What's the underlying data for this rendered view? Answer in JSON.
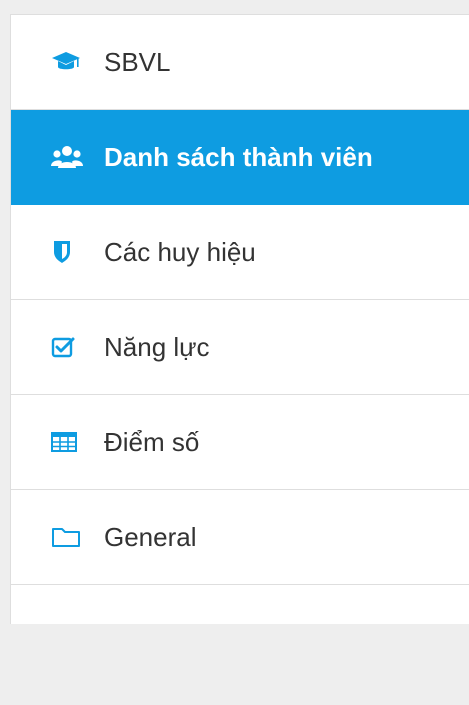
{
  "nav": {
    "items": [
      {
        "label": "SBVL",
        "icon": "graduation-cap-icon",
        "active": false
      },
      {
        "label": "Danh sách thành viên",
        "icon": "users-icon",
        "active": true
      },
      {
        "label": "Các huy hiệu",
        "icon": "shield-icon",
        "active": false
      },
      {
        "label": "Năng lực",
        "icon": "checkbox-icon",
        "active": false
      },
      {
        "label": "Điểm số",
        "icon": "table-icon",
        "active": false
      },
      {
        "label": "General",
        "icon": "folder-icon",
        "active": false
      }
    ]
  },
  "colors": {
    "accent": "#0e9ce1",
    "icon": "#0e9ce1",
    "text": "#333333",
    "border": "#dedede"
  }
}
